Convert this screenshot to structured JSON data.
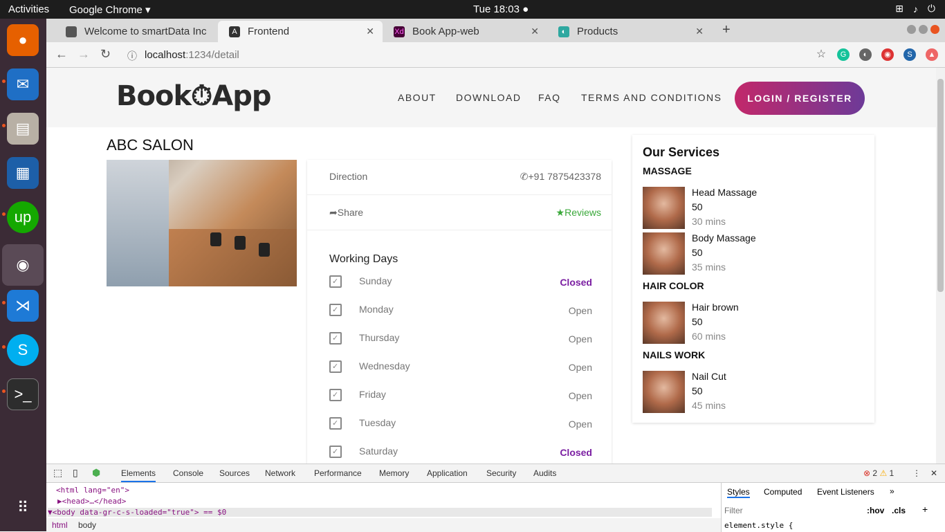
{
  "system": {
    "activities": "Activities",
    "app_name": "Google Chrome ▾",
    "clock": "Tue 18:03 ●"
  },
  "browser": {
    "tabs": [
      {
        "label": "Welcome to smartData Inc",
        "active": false
      },
      {
        "label": "Frontend",
        "active": true
      },
      {
        "label": "Book App-web",
        "active": false
      },
      {
        "label": "Products",
        "active": false
      }
    ],
    "url_host": "localhost",
    "url_path": ":1234/detail"
  },
  "site": {
    "logo": "Book⏱App",
    "nav": [
      "ABOUT",
      "DOWNLOAD",
      "FAQ",
      "TERMS AND CONDITIONS"
    ],
    "login": "LOGIN / REGISTER"
  },
  "salon": {
    "name": "ABC SALON",
    "direction": "Direction",
    "phone": "+91 7875423378",
    "share": "Share",
    "reviews": "Reviews",
    "working_days_title": "Working Days",
    "days": [
      {
        "day": "Sunday",
        "status": "Closed"
      },
      {
        "day": "Monday",
        "status": "Open"
      },
      {
        "day": "Thursday",
        "status": "Open"
      },
      {
        "day": "Wednesday",
        "status": "Open"
      },
      {
        "day": "Friday",
        "status": "Open"
      },
      {
        "day": "Tuesday",
        "status": "Open"
      },
      {
        "day": "Saturday",
        "status": "Closed"
      }
    ]
  },
  "services": {
    "title": "Our Services",
    "categories": [
      {
        "name": "MASSAGE",
        "items": [
          {
            "name": "Head Massage",
            "price": "50",
            "duration": "30 mins"
          },
          {
            "name": "Body Massage",
            "price": "50",
            "duration": "35 mins"
          }
        ]
      },
      {
        "name": "HAIR COLOR",
        "items": [
          {
            "name": "Hair brown",
            "price": "50",
            "duration": "60 mins"
          }
        ]
      },
      {
        "name": "NAILS WORK",
        "items": [
          {
            "name": "Nail Cut",
            "price": "50",
            "duration": "45 mins"
          }
        ]
      }
    ]
  },
  "devtools": {
    "tabs": [
      "Elements",
      "Console",
      "Sources",
      "Network",
      "Performance",
      "Memory",
      "Application",
      "Security",
      "Audits"
    ],
    "errors": "2",
    "warnings": "1",
    "code_lines": [
      "<html lang=\"en\">",
      "▶<head>…</head>",
      "▼<body data-gr-c-s-loaded=\"true\"> == $0"
    ],
    "breadcrumbs": [
      "html",
      "body"
    ],
    "style_tabs": [
      "Styles",
      "Computed",
      "Event Listeners",
      "»"
    ],
    "filter_placeholder": "Filter",
    "hov": ":hov",
    "cls": ".cls",
    "element_style": "element.style {"
  }
}
